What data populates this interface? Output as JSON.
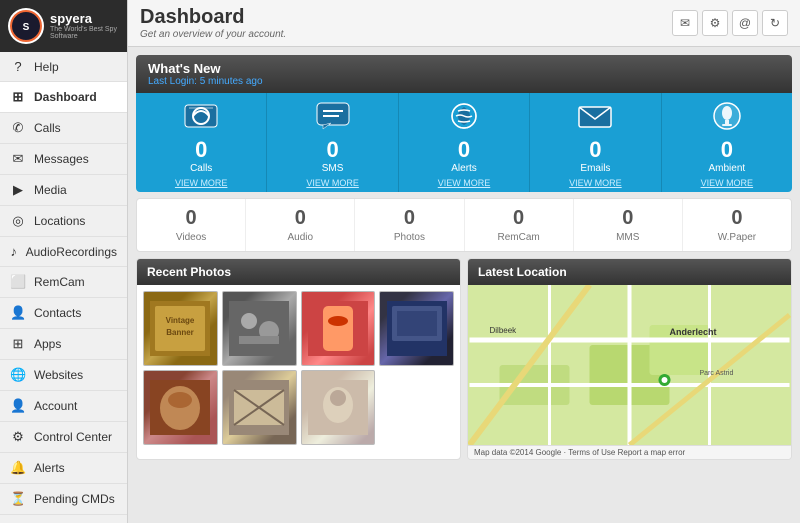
{
  "logo": {
    "text": "spyera",
    "subtext": "The World's Best Spy Software"
  },
  "sidebar": {
    "items": [
      {
        "id": "help",
        "label": "Help",
        "icon": "?"
      },
      {
        "id": "dashboard",
        "label": "Dashboard",
        "icon": "⊞",
        "active": true
      },
      {
        "id": "calls",
        "label": "Calls",
        "icon": "✆"
      },
      {
        "id": "messages",
        "label": "Messages",
        "icon": "✉"
      },
      {
        "id": "media",
        "label": "Media",
        "icon": "▶"
      },
      {
        "id": "locations",
        "label": "Locations",
        "icon": "◎"
      },
      {
        "id": "audio-recordings",
        "label": "AudioRecordings",
        "icon": "♪"
      },
      {
        "id": "remcam",
        "label": "RemCam",
        "icon": "📷"
      },
      {
        "id": "contacts",
        "label": "Contacts",
        "icon": "👤"
      },
      {
        "id": "apps",
        "label": "Apps",
        "icon": "⊞"
      },
      {
        "id": "websites",
        "label": "Websites",
        "icon": "🌐"
      },
      {
        "id": "account",
        "label": "Account",
        "icon": "👤"
      },
      {
        "id": "control-center",
        "label": "Control Center",
        "icon": "⚙"
      },
      {
        "id": "alerts",
        "label": "Alerts",
        "icon": "🔔"
      },
      {
        "id": "pending-cmds",
        "label": "Pending CMDs",
        "icon": "⏳"
      }
    ]
  },
  "header": {
    "title": "Dashboard",
    "subtitle": "Get an overview of your account.",
    "icons": [
      "✉",
      "⚙",
      "@",
      "↻"
    ]
  },
  "whats_new": {
    "title": "What's New",
    "last_login": "Last Login: 5 minutes ago"
  },
  "stats": [
    {
      "id": "calls",
      "icon": "📞",
      "count": "0",
      "label": "Calls",
      "viewmore": "VIEW MORE"
    },
    {
      "id": "sms",
      "icon": "💬",
      "count": "0",
      "label": "SMS",
      "viewmore": "VIEW MORE"
    },
    {
      "id": "alerts",
      "icon": "📡",
      "count": "0",
      "label": "Alerts",
      "viewmore": "VIEW MORE"
    },
    {
      "id": "emails",
      "icon": "✉",
      "count": "0",
      "label": "Emails",
      "viewmore": "VIEW MORE"
    },
    {
      "id": "ambient",
      "icon": "🎙",
      "count": "0",
      "label": "Ambient",
      "viewmore": "VIEW MORE"
    }
  ],
  "stats2": [
    {
      "id": "videos",
      "count": "0",
      "label": "Videos"
    },
    {
      "id": "audio",
      "count": "0",
      "label": "Audio"
    },
    {
      "id": "photos",
      "count": "0",
      "label": "Photos"
    },
    {
      "id": "remcam",
      "count": "0",
      "label": "RemCam"
    },
    {
      "id": "mms",
      "count": "0",
      "label": "MMS"
    },
    {
      "id": "wpaper",
      "count": "0",
      "label": "W.Paper"
    }
  ],
  "recent_photos": {
    "title": "Recent Photos"
  },
  "latest_location": {
    "title": "Latest Location",
    "location_name": "Anderlecht",
    "map_footer": "Map data ©2014 Google · Terms of Use  Report a map error"
  }
}
